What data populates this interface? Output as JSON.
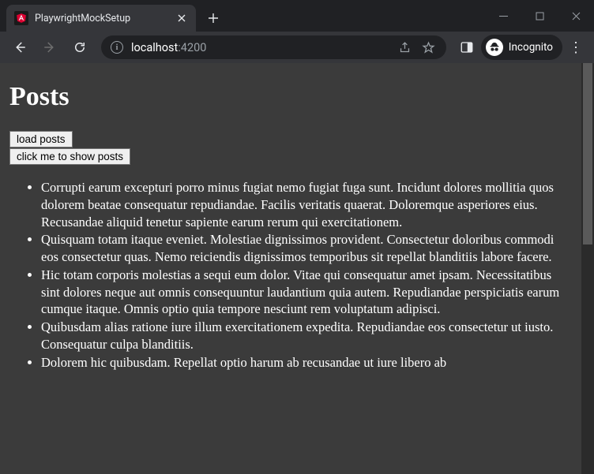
{
  "window": {
    "tab_title": "PlaywrightMockSetup"
  },
  "address_bar": {
    "host": "localhost",
    "port": ":4200"
  },
  "incognito_label": "Incognito",
  "page": {
    "heading": "Posts",
    "buttons": {
      "load": "load posts",
      "show": "click me to show posts"
    },
    "posts": [
      "Corrupti earum excepturi porro minus fugiat nemo fugiat fuga sunt. Incidunt dolores mollitia quos dolorem beatae consequatur repudiandae. Facilis veritatis quaerat. Doloremque asperiores eius. Recusandae aliquid tenetur sapiente earum rerum qui exercitationem.",
      "Quisquam totam itaque eveniet. Molestiae dignissimos provident. Consectetur doloribus commodi eos consectetur quas. Nemo reiciendis dignissimos temporibus sit repellat blanditiis labore facere.",
      "Hic totam corporis molestias a sequi eum dolor. Vitae qui consequatur amet ipsam. Necessitatibus sint dolores neque aut omnis consequuntur laudantium quia autem. Repudiandae perspiciatis earum cumque itaque. Omnis optio quia tempore nesciunt rem voluptatum adipisci.",
      "Quibusdam alias ratione iure illum exercitationem expedita. Repudiandae eos consectetur ut iusto. Consequatur culpa blanditiis.",
      "Dolorem hic quibusdam. Repellat optio harum ab recusandae ut iure libero ab"
    ]
  }
}
